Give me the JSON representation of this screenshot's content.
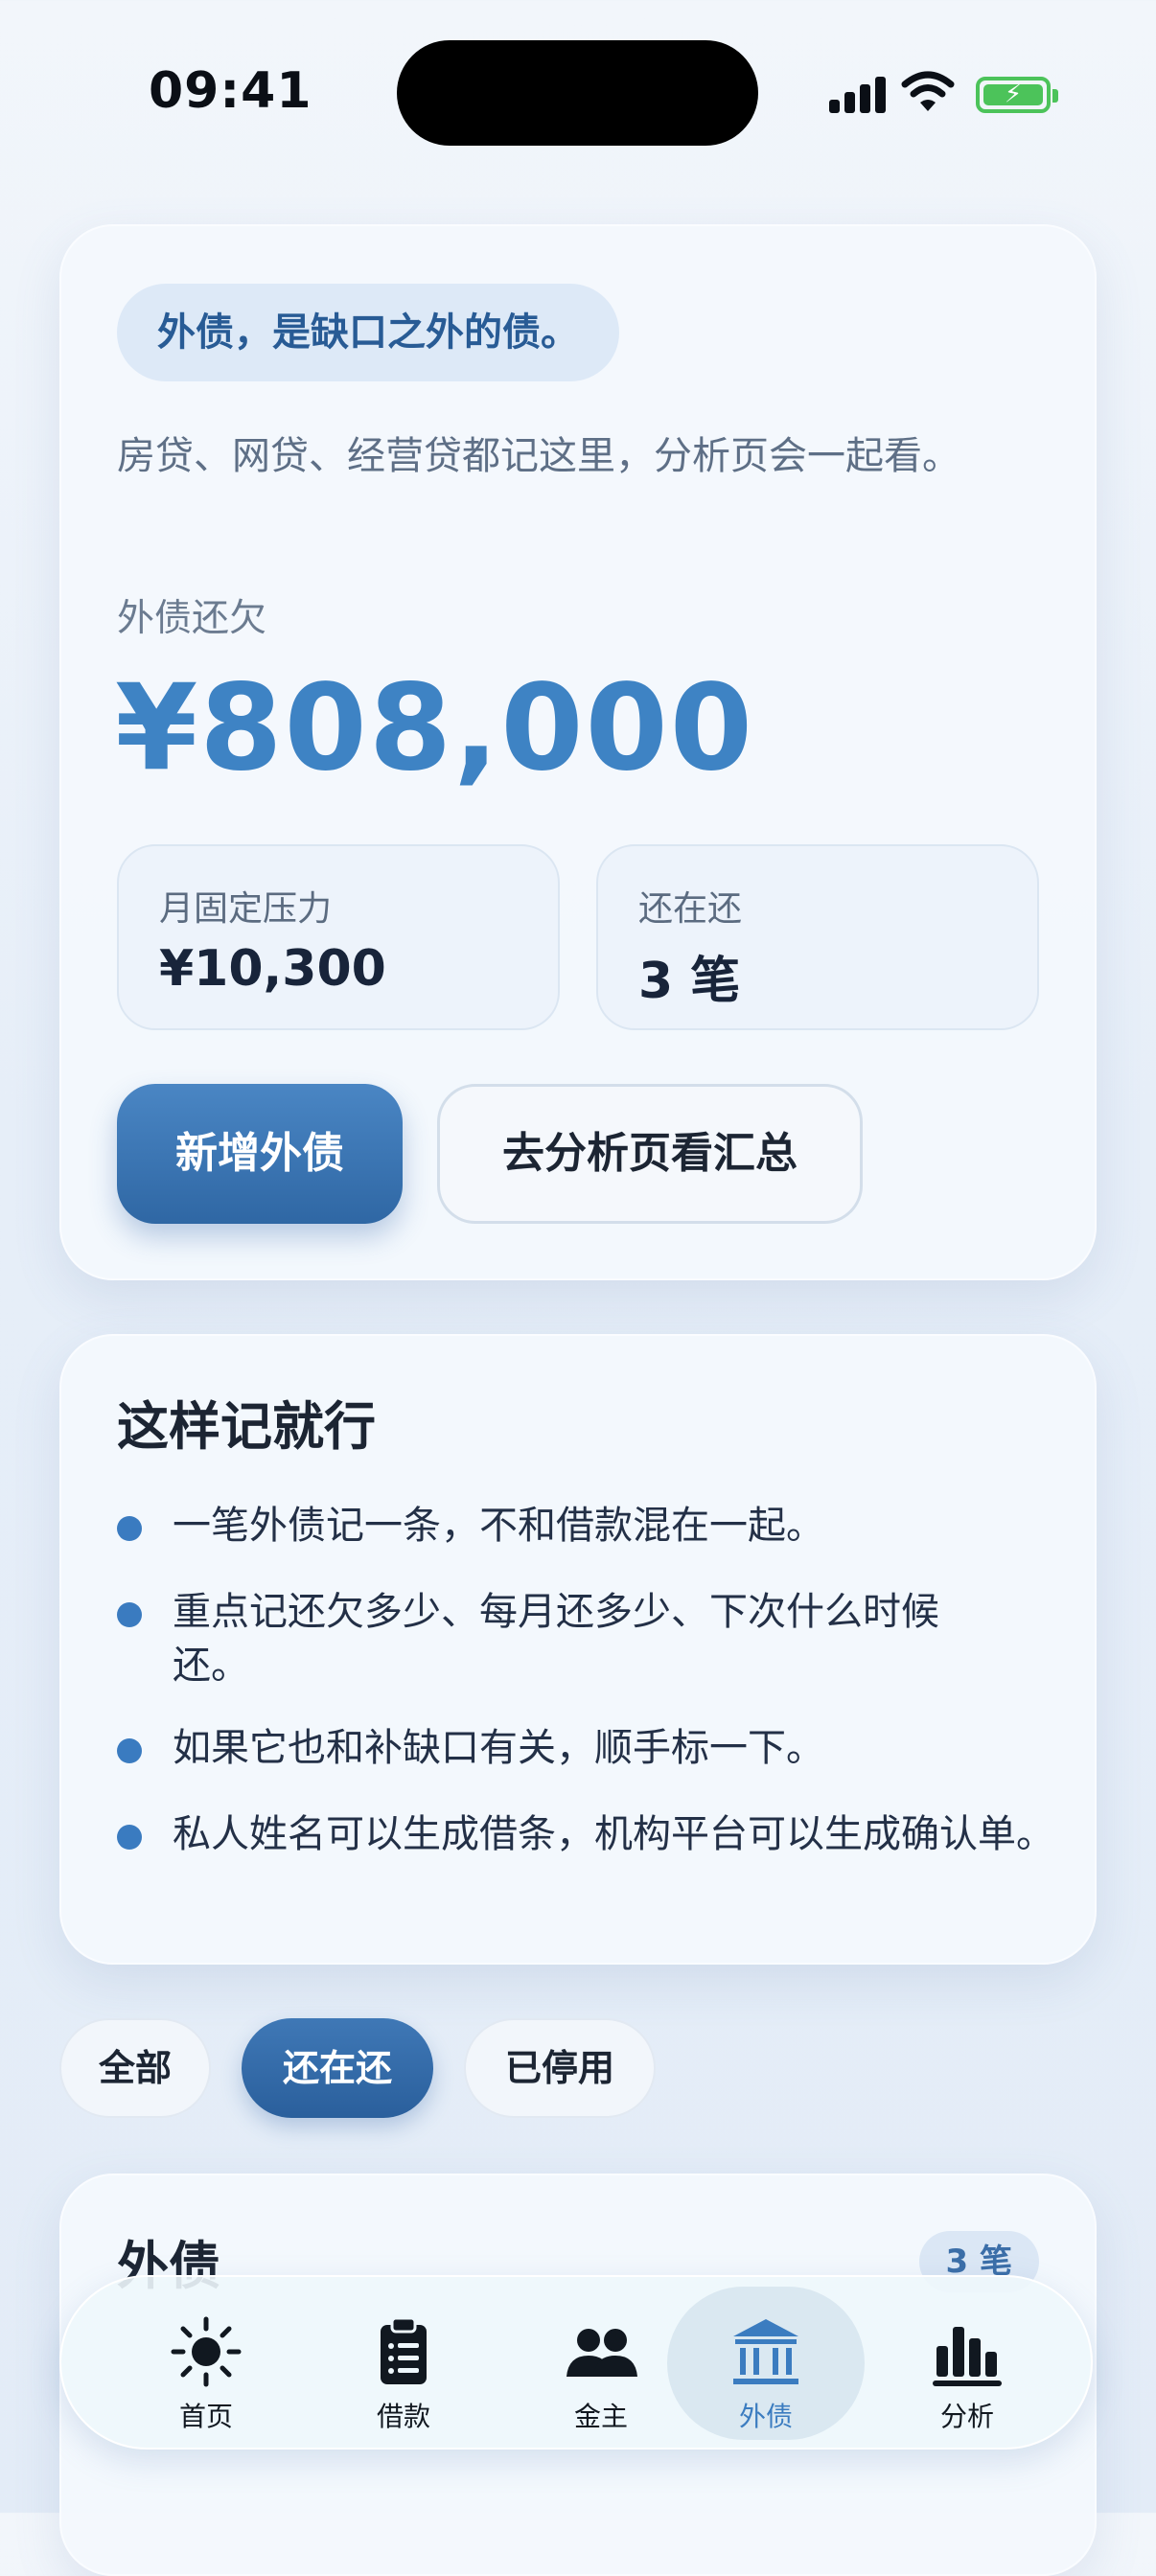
{
  "status_bar": {
    "time": "09:41"
  },
  "hero": {
    "chip": "外债，是缺口之外的债。",
    "description": "房贷、网贷、经营贷都记这里，分析页会一起看。",
    "outstanding_label": "外债还欠",
    "outstanding_amount": "¥808,000",
    "stats": [
      {
        "label": "月固定压力",
        "value": "¥10,300"
      },
      {
        "label": "还在还",
        "value": "3 笔"
      }
    ],
    "primary_button": "新增外债",
    "secondary_button": "去分析页看汇总"
  },
  "tips": {
    "title": "这样记就行",
    "items": [
      "一笔外债记一条，不和借款混在一起。",
      "重点记还欠多少、每月还多少、下次什么时候还。",
      "如果它也和补缺口有关，顺手标一下。",
      "私人姓名可以生成借条，机构平台可以生成确认单。"
    ]
  },
  "filters": {
    "items": [
      "全部",
      "还在还",
      "已停用"
    ],
    "selected": "还在还"
  },
  "list": {
    "title": "外债",
    "badge": "3 笔"
  },
  "tab_bar": {
    "items": [
      {
        "label": "首页",
        "icon": "sun-icon"
      },
      {
        "label": "借款",
        "icon": "clipboard-icon"
      },
      {
        "label": "金主",
        "icon": "people-icon"
      },
      {
        "label": "外债",
        "icon": "bank-icon"
      },
      {
        "label": "分析",
        "icon": "bar-chart-icon"
      }
    ],
    "active": "外债"
  },
  "colors": {
    "accent": "#3e83c4",
    "primary_button": "#2f67a4",
    "battery": "#4cc35a"
  }
}
